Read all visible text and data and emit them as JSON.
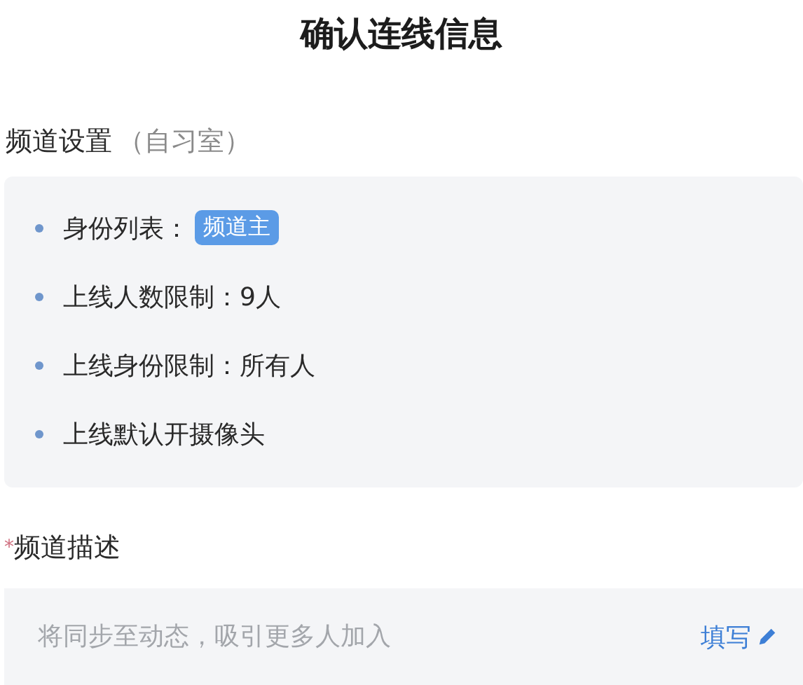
{
  "title": "确认连线信息",
  "section": {
    "name": "频道设置",
    "note": "（自习室）"
  },
  "items": [
    {
      "kind": "tag",
      "label": "身份列表：",
      "tag": "频道主"
    },
    {
      "kind": "text",
      "text": "上线人数限制：9人"
    },
    {
      "kind": "text",
      "text": "上线身份限制：所有人"
    },
    {
      "kind": "text",
      "text": "上线默认开摄像头"
    }
  ],
  "description": {
    "label": "频道描述",
    "required_mark": "*",
    "placeholder": "将同步至动态，吸引更多人加入",
    "action": "填写"
  }
}
